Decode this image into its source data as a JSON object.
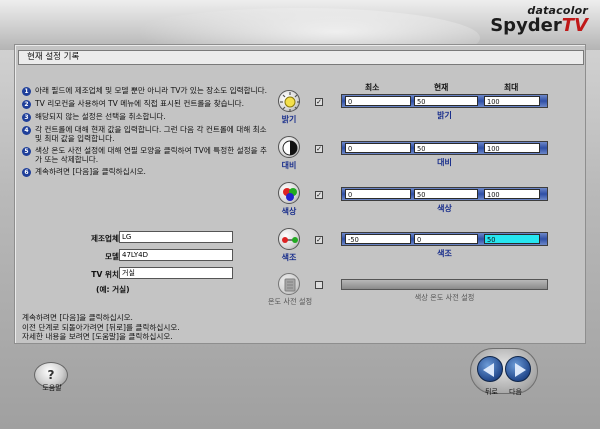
{
  "logo": {
    "brand": "datacolor",
    "product_main": "Spyder",
    "product_tv": "TV"
  },
  "title": "현재 설정 기록",
  "steps": [
    {
      "num": "1",
      "text": "아래 필드에 제조업체 및 모델 뿐만 아니라 TV가 있는 장소도 입력합니다."
    },
    {
      "num": "2",
      "text": "TV 리모컨을 사용하여 TV 메뉴에 직접 표시된 컨트롤을 찾습니다."
    },
    {
      "num": "3",
      "text": "해당되지 않는 설정은 선택을 취소합니다."
    },
    {
      "num": "4",
      "text": "각 컨트롤에 대해 현재 값을 입력합니다. 그런 다음 각 컨트롤에 대해 최소 및 최대 값을 입력합니다."
    },
    {
      "num": "5",
      "text": "색상 온도 사전 설정에 대해 연필 모양을 클릭하여 TV에 특정한 설정을 추가 또는 삭제합니다."
    },
    {
      "num": "6",
      "text": "계속하려면 [다음]을 클릭하십시오."
    }
  ],
  "form": {
    "manufacturer_label": "제조업체:",
    "manufacturer_value": "LG",
    "model_label": "모델:",
    "model_value": "47LY4D",
    "location_label": "TV 위치:",
    "location_value": "거실",
    "note": "(예: 거실)"
  },
  "footer_lines": [
    "계속하려면 [다음]을 클릭하십시오.",
    "이전 단계로 되돌아가려면 [뒤로]를 클릭하십시오.",
    "자세한 내용을 보려면 [도움말]을 클릭하십시오."
  ],
  "columns": {
    "min": "최소",
    "current": "현재",
    "max": "최대"
  },
  "controls": [
    {
      "name": "밝기",
      "icon": "sun-brightness-icon",
      "checked": "✓",
      "min": "0",
      "current": "50",
      "max": "100",
      "slider_label": "밝기"
    },
    {
      "name": "대비",
      "icon": "contrast-icon",
      "checked": "✓",
      "min": "0",
      "current": "50",
      "max": "100",
      "slider_label": "대비"
    },
    {
      "name": "색상",
      "icon": "color-dots-icon",
      "checked": "✓",
      "min": "0",
      "current": "50",
      "max": "100",
      "slider_label": "색상"
    },
    {
      "name": "색조",
      "icon": "tint-dots-icon",
      "checked": "✓",
      "min": "-50",
      "current": "0",
      "max": "50",
      "slider_label": "색조"
    }
  ],
  "temp_preset": {
    "name": "온도 사전 설정",
    "slider_label": "색상 온도 사전 설정",
    "checked": ""
  },
  "buttons": {
    "help": "도움말",
    "help_glyph": "?",
    "back": "뒤로",
    "next": "다음"
  }
}
